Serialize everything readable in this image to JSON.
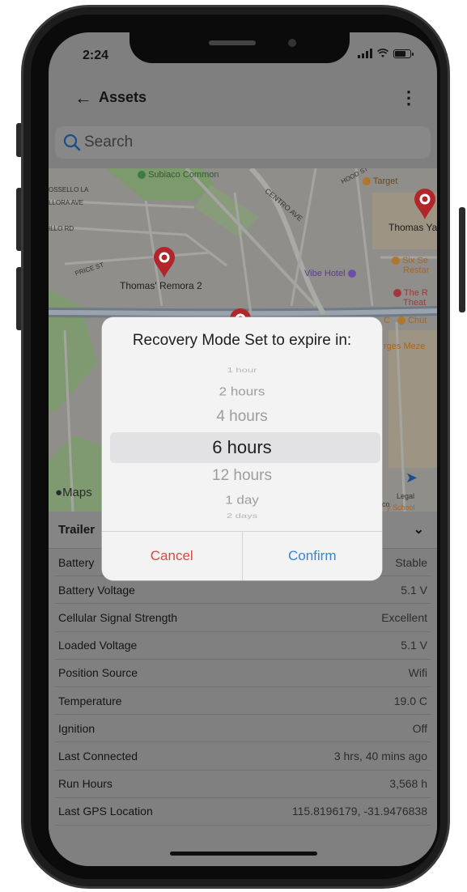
{
  "status_bar": {
    "time": "2:24"
  },
  "header": {
    "title": "Assets"
  },
  "search": {
    "placeholder": "Search"
  },
  "map": {
    "labels": {
      "subiaco_common": "Subiaco Common",
      "target": "Target",
      "ossello": "OSSELLO LA",
      "llora": "LLORA AVE",
      "centro": "CENTRO AVE",
      "hood": "HOOD ST",
      "thomas_yal": "Thomas Yal",
      "illo_rd": "ILLO RD",
      "price_st": "PRICE ST",
      "thomas_remora": "Thomas' Remora 2",
      "vibe_hotel": "Vibe Hotel",
      "six_se": "Six Se",
      "restar": "Restar",
      "the_r": "The R",
      "theat": "Theat",
      "chut": "Chut",
      "c_letter": "C",
      "rges_meze": "rges Meze",
      "co_legal": "co",
      "legal": "Legal",
      "school": "y School"
    },
    "attribution": "Maps"
  },
  "panel": {
    "title": "Trailer",
    "rows": [
      {
        "label": "Battery",
        "value": "Stable"
      },
      {
        "label": "Battery Voltage",
        "value": "5.1 V"
      },
      {
        "label": "Cellular Signal Strength",
        "value": "Excellent"
      },
      {
        "label": "Loaded Voltage",
        "value": "5.1 V"
      },
      {
        "label": "Position Source",
        "value": "Wifi"
      },
      {
        "label": "Temperature",
        "value": "19.0 C"
      },
      {
        "label": "Ignition",
        "value": "Off"
      },
      {
        "label": "Last Connected",
        "value": "3 hrs, 40 mins ago"
      },
      {
        "label": "Run Hours",
        "value": "3,568 h"
      },
      {
        "label": "Last GPS Location",
        "value": "115.8196179, -31.9476838"
      }
    ]
  },
  "dialog": {
    "title": "Recovery Mode Set to expire in:",
    "options": [
      "1 hour",
      "2 hours",
      "4 hours",
      "6 hours",
      "12 hours",
      "1 day",
      "2 days"
    ],
    "selected": "6 hours",
    "cancel": "Cancel",
    "confirm": "Confirm"
  },
  "colors": {
    "cancel": "#e2453c",
    "confirm": "#2f86e8",
    "pin": "#c1272d"
  }
}
